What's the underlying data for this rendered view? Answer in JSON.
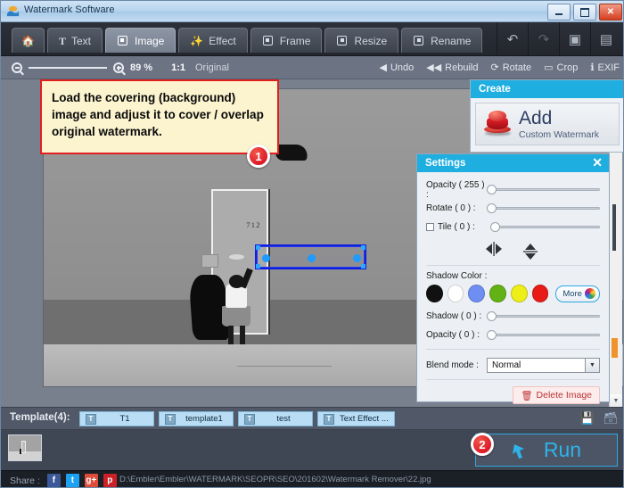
{
  "window": {
    "title": "Watermark Software",
    "icon": "app-icon",
    "minimize": "minimize",
    "maximize": "maximize",
    "close": "close"
  },
  "tabs": [
    {
      "label": "",
      "icon": "home-icon",
      "name": "tab-home",
      "active": false
    },
    {
      "label": "Text",
      "icon": "text-icon",
      "name": "tab-text",
      "active": false
    },
    {
      "label": "Image",
      "icon": "image-icon",
      "name": "tab-image",
      "active": true
    },
    {
      "label": "Effect",
      "icon": "effect-icon",
      "name": "tab-effect",
      "active": false
    },
    {
      "label": "Frame",
      "icon": "frame-icon",
      "name": "tab-frame",
      "active": false
    },
    {
      "label": "Resize",
      "icon": "resize-icon",
      "name": "tab-resize",
      "active": false
    },
    {
      "label": "Rename",
      "icon": "rename-icon",
      "name": "tab-rename",
      "active": false
    }
  ],
  "title_actions": [
    {
      "name": "undo-icon",
      "glyph": "↶"
    },
    {
      "name": "redo-icon",
      "glyph": "↷"
    },
    {
      "name": "feedback-icon",
      "glyph": "▣"
    },
    {
      "name": "help-icon",
      "glyph": "▤"
    }
  ],
  "toolbar": {
    "zoom_out": "zoom-out",
    "zoom_in": "zoom-in",
    "zoom_percent": "89 %",
    "one_to_one": "1:1",
    "original": "Original",
    "actions": [
      {
        "label": "Undo",
        "glyph": "◀",
        "name": "undo-button"
      },
      {
        "label": "Rebuild",
        "glyph": "◀◀",
        "name": "rebuild-button"
      },
      {
        "label": "Rotate",
        "glyph": "⟳",
        "name": "rotate-button"
      },
      {
        "label": "Crop",
        "glyph": "▭",
        "name": "crop-button"
      },
      {
        "label": "EXIF",
        "glyph": "ℹ",
        "name": "exif-button"
      }
    ]
  },
  "callout": {
    "text": "Load the covering (background) image and adjust it to cover / overlap original watermark.",
    "badge": "1"
  },
  "create": {
    "header": "Create",
    "add_label": "Add",
    "add_sub": "Custom Watermark",
    "icon": "stamp-icon"
  },
  "settings": {
    "header": "Settings",
    "close": "✕",
    "opacity_label": "Opacity ( 255 ) :",
    "rotate_label": "Rotate ( 0 ) :",
    "tile_label": "Tile ( 0 ) :",
    "flip_h": "flip-horizontal",
    "flip_v": "flip-vertical",
    "shadow_color_label": "Shadow Color :",
    "swatches": [
      "#111111",
      "#ffffff",
      "#6f8ef2",
      "#62b215",
      "#eeee18",
      "#e81b16"
    ],
    "more_label": "More",
    "shadow_label": "Shadow ( 0 ) :",
    "shadow_opacity_label": "Opacity ( 0 ) :",
    "blend_label": "Blend mode :",
    "blend_value": "Normal",
    "delete_label": "Delete Image",
    "delete_icon": "trash-icon"
  },
  "canvas": {
    "door_number": "712",
    "selection": "watermark-selection"
  },
  "templates": {
    "label": "Template(4):",
    "items": [
      {
        "name": "T1",
        "icon": "T"
      },
      {
        "name": "template1",
        "icon": "T"
      },
      {
        "name": "test",
        "icon": "T"
      },
      {
        "name": "Text Effect ...",
        "icon": "T"
      }
    ],
    "save": "save-icon",
    "save_as": "save-as-icon"
  },
  "run": {
    "label": "Run",
    "badge": "2",
    "icon": "run-icon"
  },
  "status": {
    "share_label": "Share :",
    "share_buttons": [
      {
        "name": "facebook-icon",
        "glyph": "f",
        "color": "#3b5998"
      },
      {
        "name": "twitter-icon",
        "glyph": "t",
        "color": "#1da1f2"
      },
      {
        "name": "google-plus-icon",
        "glyph": "g+",
        "color": "#dd4b39"
      },
      {
        "name": "pinterest-icon",
        "glyph": "p",
        "color": "#cb2027"
      }
    ],
    "path": "D:\\Embler\\Embler\\WATERMARK\\SEOPR\\SEO\\201602\\Watermark Remover\\22.jpg"
  },
  "colors": {
    "accent": "#1faee0",
    "badge": "#d0021b",
    "selection": "#0f1fe0"
  }
}
